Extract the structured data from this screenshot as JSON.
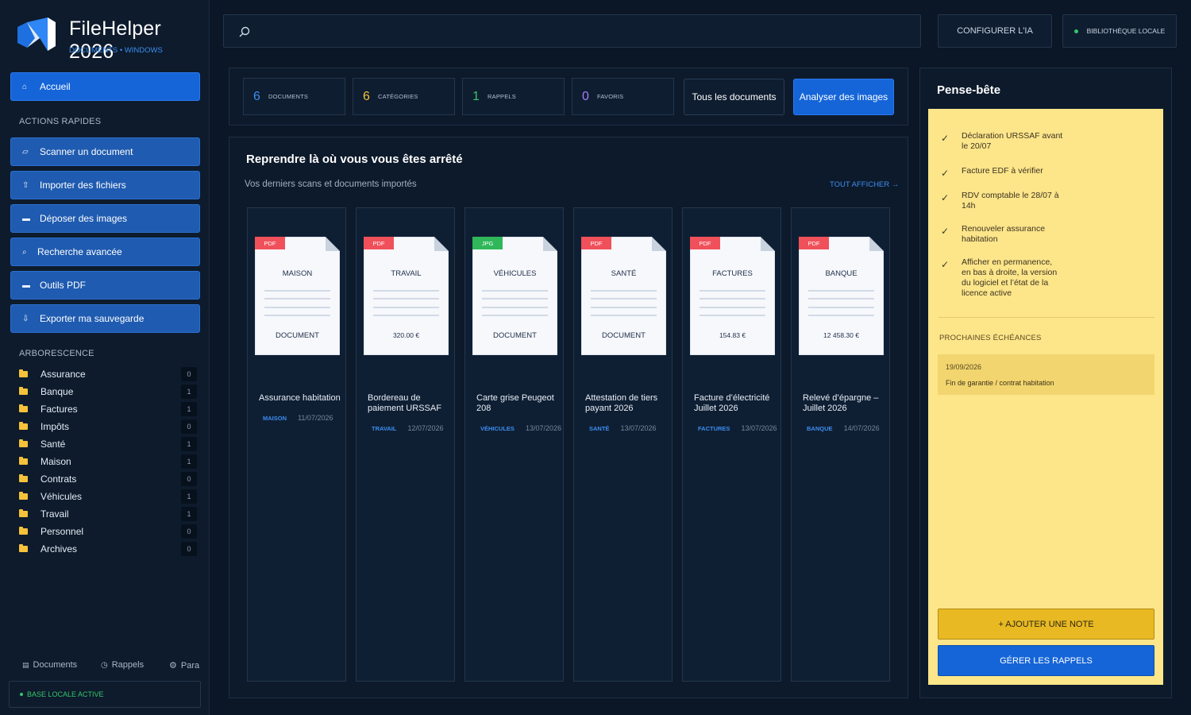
{
  "app": {
    "title": "FileHelper 2026",
    "subtitle": "DOCUMENTS • WINDOWS"
  },
  "sidebar": {
    "home_label": "Accueil",
    "quick_actions_label": "ACTIONS RAPIDES",
    "actions": [
      {
        "label": "Scanner un document",
        "icon": "scan-icon"
      },
      {
        "label": "Importer des fichiers",
        "icon": "upload-icon"
      },
      {
        "label": "Déposer des images",
        "icon": "image-icon"
      },
      {
        "label": "Recherche avancée",
        "icon": "search-icon"
      },
      {
        "label": "Outils PDF",
        "icon": "pdf-icon"
      },
      {
        "label": "Exporter ma sauvegarde",
        "icon": "download-icon"
      }
    ],
    "tree_label": "ARBORESCENCE",
    "tree": [
      {
        "label": "Assurance",
        "count": "0"
      },
      {
        "label": "Banque",
        "count": "1"
      },
      {
        "label": "Factures",
        "count": "1"
      },
      {
        "label": "Impôts",
        "count": "0"
      },
      {
        "label": "Santé",
        "count": "1"
      },
      {
        "label": "Maison",
        "count": "1"
      },
      {
        "label": "Contrats",
        "count": "0"
      },
      {
        "label": "Véhicules",
        "count": "1"
      },
      {
        "label": "Travail",
        "count": "1"
      },
      {
        "label": "Personnel",
        "count": "0"
      },
      {
        "label": "Archives",
        "count": "0"
      }
    ],
    "bottom_tabs": [
      {
        "label": "Documents",
        "icon": "documents-icon"
      },
      {
        "label": "Rappels",
        "icon": "clock-icon"
      },
      {
        "label": "Para",
        "icon": "gear-icon"
      }
    ],
    "status": "BASE LOCALE ACTIVE"
  },
  "topbar": {
    "search_placeholder": "",
    "configure_label": "CONFIGURER L'IA",
    "library_label": "BIBLIOTHÈQUE LOCALE"
  },
  "stats": [
    {
      "value": "6",
      "label": "DOCUMENTS",
      "color": "#3b8df0"
    },
    {
      "value": "6",
      "label": "CATÉGORIES",
      "color": "#f5c23a"
    },
    {
      "value": "1",
      "label": "RAPPELS",
      "color": "#38c46a"
    },
    {
      "value": "0",
      "label": "FAVORIS",
      "color": "#a67cf5"
    }
  ],
  "tabs": {
    "all_docs": "Tous les documents",
    "analyze": "Analyser des images"
  },
  "recent": {
    "title": "Reprendre là où vous vous êtes arrêté",
    "subtitle": "Vos derniers scans et documents importés",
    "see_all": "TOUT AFFICHER →",
    "cards": [
      {
        "type": "PDF",
        "type_color": "#f0505a",
        "category_upper": "MAISON",
        "footer": "DOCUMENT",
        "title1": "Assurance habitation",
        "title2": "",
        "category": "MAISON",
        "date": "11/07/2026"
      },
      {
        "type": "PDF",
        "type_color": "#f0505a",
        "category_upper": "TRAVAIL",
        "footer": "320.00 €",
        "title1": "Bordereau de",
        "title2": "paiement URSSAF",
        "category": "TRAVAIL",
        "date": "12/07/2026"
      },
      {
        "type": "JPG",
        "type_color": "#2fb75a",
        "category_upper": "VÉHICULES",
        "footer": "DOCUMENT",
        "title1": "Carte grise Peugeot",
        "title2": "208",
        "category": "VÉHICULES",
        "date": "13/07/2026"
      },
      {
        "type": "PDF",
        "type_color": "#f0505a",
        "category_upper": "SANTÉ",
        "footer": "DOCUMENT",
        "title1": "Attestation de tiers",
        "title2": "payant 2026",
        "category": "SANTÉ",
        "date": "13/07/2026"
      },
      {
        "type": "PDF",
        "type_color": "#f0505a",
        "category_upper": "FACTURES",
        "footer": "154.83 €",
        "title1": "Facture d’électricité",
        "title2": "Juillet 2026",
        "category": "FACTURES",
        "date": "13/07/2026"
      },
      {
        "type": "PDF",
        "type_color": "#f0505a",
        "category_upper": "BANQUE",
        "footer": "12 458.30 €",
        "title1": "Relevé d’épargne –",
        "title2": "Juillet 2026",
        "category": "BANQUE",
        "date": "14/07/2026"
      }
    ]
  },
  "notes": {
    "title": "Pense-bête",
    "items": [
      {
        "text": "Déclaration URSSAF avant le 20/07"
      },
      {
        "text": "Facture EDF à vérifier"
      },
      {
        "text": "RDV comptable le 28/07 à 14h"
      },
      {
        "text": "Renouveler assurance habitation"
      },
      {
        "text": "Afficher en permanence, en bas à droite, la version du logiciel et l’état de la licence active"
      }
    ],
    "deadlines_label": "PROCHAINES ÉCHÉANCES",
    "deadline": {
      "date": "19/09/2026",
      "text": "Fin de garantie / contrat habitation"
    },
    "add_label": "+ AJOUTER UNE NOTE",
    "manage_label": "GÉRER LES RAPPELS"
  }
}
